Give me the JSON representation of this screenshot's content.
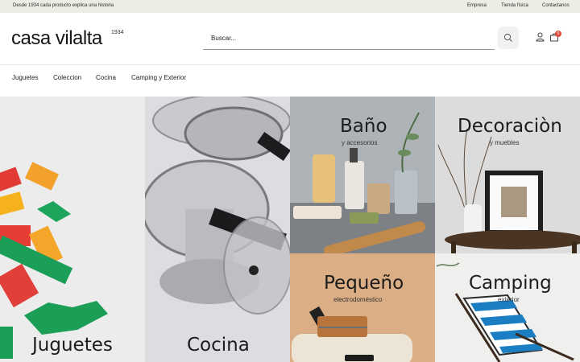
{
  "topbar": {
    "tagline": "Desde 1934 cada producto explica una historia",
    "links": [
      "Empresa",
      "Tienda física",
      "Contactanos"
    ]
  },
  "header": {
    "logo": "casa vilalta",
    "logo_year": "1934",
    "search_placeholder": "Buscar...",
    "cart_count": "0"
  },
  "nav": {
    "items": [
      "Juguetes",
      "Coleccion",
      "Cocina",
      "Camping y Exterior"
    ]
  },
  "categories": [
    {
      "title": "Juguetes",
      "subtitle": ""
    },
    {
      "title": "Cocina",
      "subtitle": ""
    },
    {
      "title": "Baño",
      "subtitle": "y accesorios"
    },
    {
      "title": "Decoraciòn",
      "subtitle": "y muebles"
    },
    {
      "title": "Pequeño",
      "subtitle": "electrodoméstico"
    },
    {
      "title": "Camping",
      "subtitle": "exterior"
    }
  ],
  "colors": {
    "topbar_bg": "#eceee6",
    "cart_badge": "#e14b3b",
    "accent_bg": "#f1f1f1"
  },
  "icons": [
    "search-icon",
    "user-icon",
    "cart-icon"
  ]
}
